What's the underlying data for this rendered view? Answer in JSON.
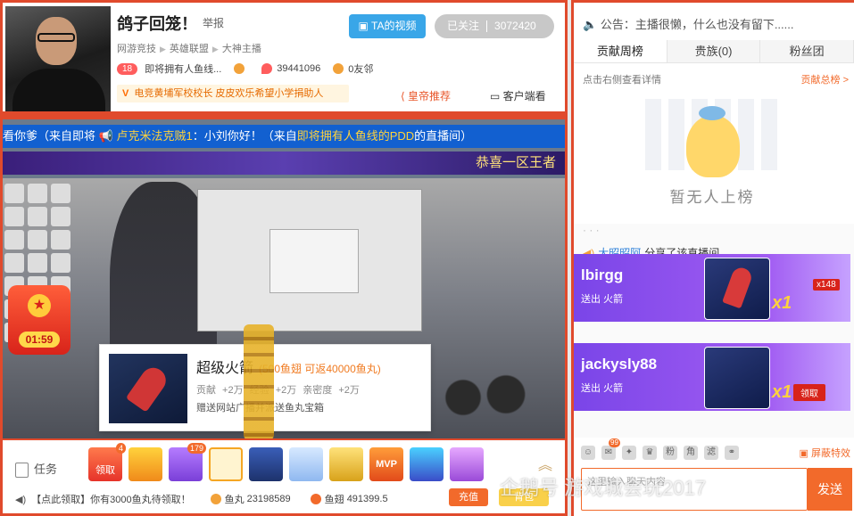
{
  "streamer": {
    "name": "鸽子回笼！",
    "report_label": "举报",
    "video_button": "TA的视频",
    "follow_label": "已关注",
    "follow_count": "3072420",
    "breadcrumb": [
      "网游竞技",
      "英雄联盟",
      "大神主播"
    ],
    "level": "18",
    "stream_title": "即将拥有人鱼线...",
    "heat": "39441096",
    "friends": "0友邻",
    "notice": "电竞黄埔军校校长 皮皮欢乐希望小学捐助人",
    "notice_prefix": "V",
    "emperor_rec": "皇帝推荐",
    "customer_service": "客户端看"
  },
  "video": {
    "danmu_prefix": "看你爹（来自即将",
    "danmu_user": "卢克米法克贼1",
    "danmu_text": "：小刘你好！（来自",
    "danmu_hl": "即将拥有人鱼线的PDD",
    "danmu_suffix": "的直播间）",
    "banner_right": "恭喜一区王者",
    "red_packet_timer": "01:59",
    "gift_tip": {
      "name": "超级火箭",
      "price": "(500鱼翅 可返40000鱼丸)",
      "stats": "贡献 +2万 经验 +2万 亲密度 +2万",
      "desc": "赠送网站广播并派送鱼丸宝箱"
    }
  },
  "toolbar": {
    "task_label": "任务",
    "gifts": [
      {
        "name": "领取",
        "badge": "4"
      },
      {
        "name": "幸运宝藏",
        "badge": ""
      },
      {
        "name": "幸运时刻",
        "badge": "179"
      },
      {
        "name": "超级火箭",
        "badge": ""
      },
      {
        "name": "火箭",
        "badge": ""
      },
      {
        "name": "飞机",
        "badge": ""
      },
      {
        "name": "办卡",
        "badge": ""
      },
      {
        "name": "MVP",
        "badge": ""
      },
      {
        "name": "星球",
        "badge": ""
      },
      {
        "name": "宝石",
        "badge": ""
      }
    ],
    "claim_text": "【点此领取】你有3000鱼丸待领取！",
    "fish_ball_label": "鱼丸",
    "fish_ball": "23198589",
    "fish_fin_label": "鱼翅",
    "fish_fin": "491399.5",
    "charge": "充值",
    "bag": "背包"
  },
  "right": {
    "announcement": "公告：主播很懒，什么也没有留下......",
    "tabs": [
      "贡献周榜",
      "贵族(0)",
      "粉丝团"
    ],
    "rank_hint": "点击右侧查看详情",
    "rank_more": "贡献总榜 >",
    "empty_rank": "暂无人上榜",
    "chat": [
      {
        "user": "大昭昭阿",
        "text": "分享了该直播间"
      }
    ],
    "banners": [
      {
        "user": "lbirgg",
        "sub": "送出  火箭",
        "count": "x1",
        "combo": "x148"
      },
      {
        "user": "jackysly88",
        "sub": "送出  火箭",
        "count": "x1",
        "claim": "领取"
      }
    ],
    "shield_label": "屏蔽特效",
    "input_placeholder": "这里输入聊天内容",
    "send": "发送",
    "msg_badge": "99"
  },
  "watermark": "企鹅号 游戏城会玩2017"
}
